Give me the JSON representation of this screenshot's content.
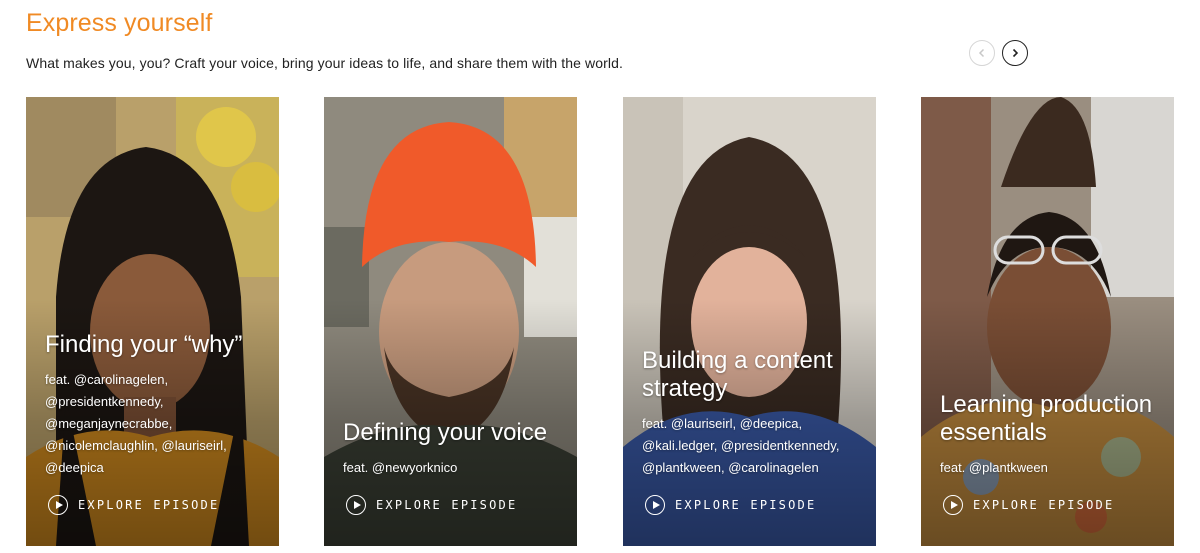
{
  "section": {
    "title": "Express yourself",
    "subtitle": "What makes you, you? Craft your voice, bring your ideas to life, and share them with the world."
  },
  "carousel": {
    "prev_icon": "chevron-left-icon",
    "next_icon": "chevron-right-icon"
  },
  "cards": [
    {
      "title": "Finding your “why”",
      "feat": "feat. @carolinagelen, @presidentkennedy, @meganjaynecrabbe, @nicolemclaughlin, @lauriseirl, @deepica",
      "cta": "EXPLORE EPISODE"
    },
    {
      "title": "Defining your voice",
      "feat": "feat. @newyorknico",
      "cta": "EXPLORE EPISODE"
    },
    {
      "title": "Building a content strategy",
      "feat": "feat. @lauriseirl, @deepica, @kali.ledger, @presidentkennedy, @plantkween, @carolinagelen",
      "cta": "EXPLORE EPISODE"
    },
    {
      "title": "Learning production essentials",
      "feat": "feat. @plantkween",
      "cta": "EXPLORE EPISODE"
    }
  ],
  "colors": {
    "accent": "#f08a24",
    "text": "#222222"
  }
}
